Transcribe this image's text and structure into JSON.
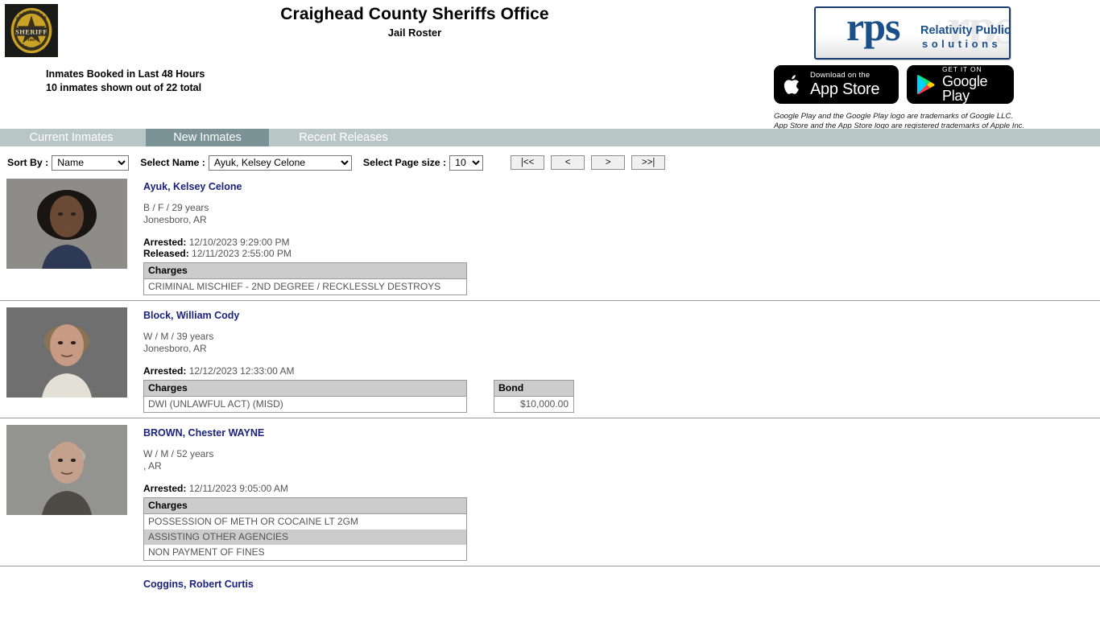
{
  "header": {
    "badge_alt": "craighead-county-sheriff-badge",
    "title": "Craighead County Sheriffs Office",
    "subtitle": "Jail Roster",
    "roster_line1": "Inmates Booked in Last 48 Hours",
    "roster_line2": "10 inmates shown out of 22 total",
    "rps": {
      "mark": "rps",
      "ghost": "rps",
      "line1": "Relativity Public Safety",
      "line2": "solutions"
    },
    "app_store": {
      "small": "Download on the",
      "big": "App Store"
    },
    "google_play": {
      "small": "GET IT ON",
      "big": "Google Play"
    },
    "trademark_line1": "Google Play and the Google Play logo are trademarks of Google LLC.",
    "trademark_line2": "App Store and the App Store logo are registered trademarks of Apple Inc."
  },
  "tabs": [
    {
      "label": "Current Inmates",
      "active": false
    },
    {
      "label": "New Inmates",
      "active": true
    },
    {
      "label": "Recent Releases",
      "active": false
    }
  ],
  "controls": {
    "sort_label": "Sort By :",
    "sort_value": "Name",
    "sort_options": [
      "Name"
    ],
    "name_label": "Select Name :",
    "name_value": "Ayuk, Kelsey Celone",
    "name_options": [
      "Ayuk, Kelsey Celone"
    ],
    "pagesize_label": "Select Page size :",
    "pagesize_value": "10",
    "pagesize_options": [
      "10"
    ],
    "pager": {
      "first": "|<<",
      "prev": "<",
      "next": ">",
      "last": ">>|"
    }
  },
  "labels": {
    "arrested": "Arrested:",
    "released": "Released:",
    "charges_header": "Charges",
    "bond_header": "Bond"
  },
  "inmates": [
    {
      "name": "Ayuk, Kelsey Celone",
      "demographics": "B / F / 29 years",
      "city": "Jonesboro, AR",
      "arrested": "12/10/2023 9:29:00 PM",
      "released": "12/11/2023 2:55:00 PM",
      "charges": [
        "CRIMINAL MISCHIEF - 2ND DEGREE / RECKLESSLY DESTROYS"
      ],
      "bond": null
    },
    {
      "name": "Block, William Cody",
      "demographics": "W / M / 39 years",
      "city": "Jonesboro, AR",
      "arrested": "12/12/2023 12:33:00 AM",
      "released": null,
      "charges": [
        "DWI (UNLAWFUL ACT) (MISD)"
      ],
      "bond": "$10,000.00"
    },
    {
      "name": "BROWN, Chester WAYNE",
      "demographics": "W / M / 52 years",
      "city": ", AR",
      "arrested": "12/11/2023 9:05:00 AM",
      "released": null,
      "charges": [
        "POSSESSION OF METH OR COCAINE LT 2GM",
        "ASSISTING OTHER AGENCIES",
        "NON PAYMENT OF FINES"
      ],
      "bond": null
    },
    {
      "name": "Coggins, Robert Curtis",
      "demographics": null,
      "city": null,
      "arrested": null,
      "released": null,
      "charges": [],
      "bond": null
    }
  ]
}
